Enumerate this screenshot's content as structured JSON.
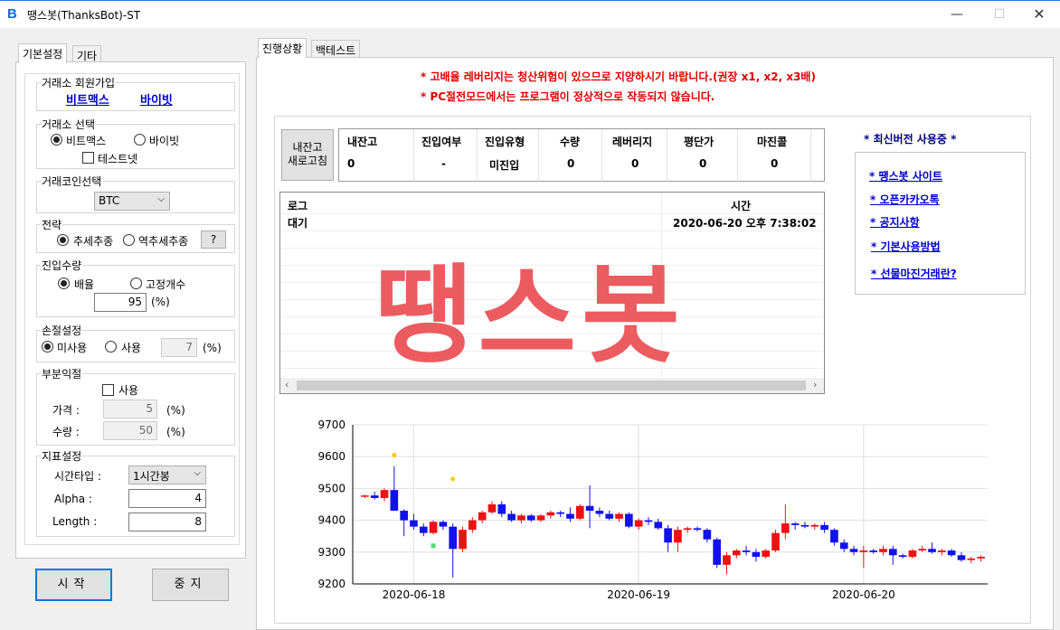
{
  "window": {
    "logo": "B",
    "title": "땡스봇(ThanksBot)-ST",
    "min_glyph": "—",
    "max_glyph": "☐",
    "close_glyph": "✕"
  },
  "left_tabs": [
    "기본설정",
    "기타"
  ],
  "exchange_join": {
    "legend": "거래소 회원가입",
    "links": [
      "비트맥스",
      "바이빗"
    ]
  },
  "exchange_select": {
    "legend": "거래소 선택",
    "options": [
      "비트맥스",
      "바이빗"
    ],
    "selected": "비트맥스",
    "testnet_label": "테스트넷",
    "testnet_checked": false
  },
  "coin_select": {
    "legend": "거래코인선택",
    "value": "BTC"
  },
  "strategy": {
    "legend": "전략",
    "options": [
      "추세추종",
      "역추세추종"
    ],
    "selected": "추세추종",
    "help_label": "?"
  },
  "entry_qty": {
    "legend": "진입수량",
    "options": [
      "배율",
      "고정개수"
    ],
    "selected": "배율",
    "value": "95",
    "unit": "(%)"
  },
  "stop_loss": {
    "legend": "손절설정",
    "options": [
      "미사용",
      "사용"
    ],
    "selected": "미사용",
    "value": "7",
    "unit": "(%)"
  },
  "partial_tp": {
    "legend": "부분익절",
    "use_label": "사용",
    "use_checked": false,
    "price_label": "가격 :",
    "price_value": "5",
    "qty_label": "수량 :",
    "qty_value": "50",
    "unit": "(%)"
  },
  "indicator": {
    "legend": "지표설정",
    "timeframe_label": "시간타입 :",
    "timeframe_value": "1시간봉",
    "alpha_label": "Alpha :",
    "alpha_value": "4",
    "length_label": "Length :",
    "length_value": "8"
  },
  "buttons": {
    "start": "시작",
    "stop": "중지",
    "refresh_balance_line1": "내잔고",
    "refresh_balance_line2": "새로고침"
  },
  "right_tabs": [
    "진행상황",
    "백테스트"
  ],
  "warnings": [
    "* 고배율 레버리지는 청산위험이 있으므로 지양하시기 바랍니다.(권장 x1, x2, x3배)",
    "* PC절전모드에서는 프로그램이 정상적으로 작동되지 않습니다."
  ],
  "status": {
    "headers": [
      "내잔고",
      "진입여부",
      "진입유형",
      "수량",
      "레버리지",
      "평단가",
      "마진콜"
    ],
    "values": [
      "0",
      "-",
      "미진입",
      "0",
      "0",
      "0",
      "0"
    ]
  },
  "log": {
    "col_log": "로그",
    "col_time": "시간",
    "rows": [
      {
        "log": "대기",
        "time": "2020-06-20 오후 7:38:02"
      }
    ]
  },
  "watermark": "땡스봇",
  "sidebar": {
    "header": "* 최신버전 사용중 *",
    "links": [
      "* 땡스봇 사이트",
      "* 오픈카카오톡",
      "* 공지사항",
      "* 기본사용방법",
      "* 선물마진거래란?"
    ]
  },
  "colors": {
    "up": "#ee1111",
    "down": "#1111ee",
    "warning": "#e00000",
    "link": "#0000cc",
    "watermark": "#ec5b60",
    "signal_yellow": "#ffcc00",
    "signal_green": "#55dd77"
  },
  "chart_data": {
    "type": "candlestick",
    "x_tick_labels": [
      "2020-06-18",
      "2020-06-19",
      "2020-06-20"
    ],
    "y_ticks": [
      9200,
      9300,
      9400,
      9500,
      9600,
      9700
    ],
    "ylim": [
      9200,
      9700
    ],
    "grid": true,
    "candles": [
      [
        9475,
        9480,
        9470,
        9478
      ],
      [
        9478,
        9490,
        9465,
        9470
      ],
      [
        9470,
        9500,
        9460,
        9495
      ],
      [
        9495,
        9570,
        9430,
        9430
      ],
      [
        9430,
        9435,
        9350,
        9400
      ],
      [
        9400,
        9420,
        9370,
        9380
      ],
      [
        9380,
        9390,
        9350,
        9360
      ],
      [
        9360,
        9400,
        9355,
        9395
      ],
      [
        9395,
        9400,
        9370,
        9380
      ],
      [
        9380,
        9390,
        9220,
        9310
      ],
      [
        9310,
        9380,
        9300,
        9370
      ],
      [
        9370,
        9410,
        9360,
        9400
      ],
      [
        9400,
        9430,
        9390,
        9425
      ],
      [
        9425,
        9460,
        9420,
        9450
      ],
      [
        9450,
        9460,
        9410,
        9420
      ],
      [
        9420,
        9430,
        9395,
        9400
      ],
      [
        9400,
        9420,
        9390,
        9415
      ],
      [
        9415,
        9420,
        9395,
        9400
      ],
      [
        9400,
        9420,
        9395,
        9415
      ],
      [
        9415,
        9430,
        9405,
        9425
      ],
      [
        9425,
        9430,
        9410,
        9420
      ],
      [
        9420,
        9440,
        9395,
        9405
      ],
      [
        9405,
        9450,
        9400,
        9445
      ],
      [
        9445,
        9510,
        9375,
        9430
      ],
      [
        9430,
        9440,
        9410,
        9420
      ],
      [
        9420,
        9430,
        9400,
        9405
      ],
      [
        9405,
        9425,
        9395,
        9420
      ],
      [
        9420,
        9425,
        9375,
        9380
      ],
      [
        9380,
        9405,
        9370,
        9400
      ],
      [
        9400,
        9410,
        9385,
        9395
      ],
      [
        9395,
        9405,
        9370,
        9375
      ],
      [
        9375,
        9385,
        9300,
        9330
      ],
      [
        9330,
        9380,
        9300,
        9370
      ],
      [
        9370,
        9380,
        9360,
        9375
      ],
      [
        9375,
        9380,
        9365,
        9370
      ],
      [
        9370,
        9375,
        9330,
        9340
      ],
      [
        9340,
        9345,
        9250,
        9260
      ],
      [
        9260,
        9300,
        9230,
        9290
      ],
      [
        9290,
        9310,
        9280,
        9305
      ],
      [
        9305,
        9320,
        9290,
        9300
      ],
      [
        9300,
        9310,
        9270,
        9285
      ],
      [
        9285,
        9310,
        9280,
        9305
      ],
      [
        9305,
        9370,
        9300,
        9360
      ],
      [
        9360,
        9450,
        9340,
        9390
      ],
      [
        9390,
        9395,
        9370,
        9385
      ],
      [
        9385,
        9395,
        9375,
        9380
      ],
      [
        9380,
        9390,
        9370,
        9385
      ],
      [
        9385,
        9395,
        9360,
        9370
      ],
      [
        9370,
        9375,
        9320,
        9330
      ],
      [
        9330,
        9340,
        9300,
        9310
      ],
      [
        9310,
        9320,
        9290,
        9300
      ],
      [
        9300,
        9320,
        9250,
        9305
      ],
      [
        9305,
        9310,
        9295,
        9300
      ],
      [
        9300,
        9320,
        9290,
        9310
      ],
      [
        9310,
        9320,
        9260,
        9290
      ],
      [
        9290,
        9295,
        9280,
        9285
      ],
      [
        9285,
        9310,
        9280,
        9305
      ],
      [
        9305,
        9320,
        9300,
        9310
      ],
      [
        9310,
        9330,
        9295,
        9300
      ],
      [
        9300,
        9310,
        9290,
        9305
      ],
      [
        9305,
        9310,
        9285,
        9290
      ],
      [
        9290,
        9300,
        9270,
        9275
      ],
      [
        9275,
        9285,
        9265,
        9280
      ],
      [
        9280,
        9290,
        9270,
        9285
      ]
    ],
    "signals": [
      {
        "index": 3,
        "y": 9605,
        "color": "yellow"
      },
      {
        "index": 9,
        "y": 9530,
        "color": "yellow"
      },
      {
        "index": 7,
        "y": 9320,
        "color": "green"
      }
    ]
  }
}
